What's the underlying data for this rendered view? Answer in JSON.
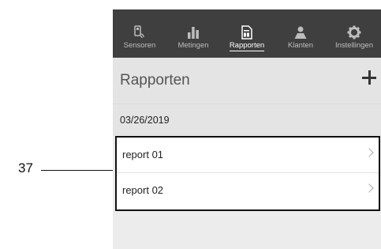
{
  "callout": {
    "number": "37"
  },
  "tabs": [
    {
      "label": "Sensoren",
      "icon": "sensor-icon",
      "active": false
    },
    {
      "label": "Metingen",
      "icon": "bar-chart-icon",
      "active": false
    },
    {
      "label": "Rapporten",
      "icon": "report-icon",
      "active": true
    },
    {
      "label": "Klanten",
      "icon": "customers-icon",
      "active": false
    },
    {
      "label": "Instellingen",
      "icon": "gear-icon",
      "active": false
    }
  ],
  "header": {
    "title": "Rapporten",
    "add_icon": "plus-icon"
  },
  "date": "03/26/2019",
  "reports": [
    {
      "name": "report 01"
    },
    {
      "name": "report 02"
    }
  ],
  "colors": {
    "tabbar": "#3f3f3f",
    "active_tab": "#ffffff",
    "inactive_tab": "#bdbdbd",
    "background": "#ececec"
  }
}
